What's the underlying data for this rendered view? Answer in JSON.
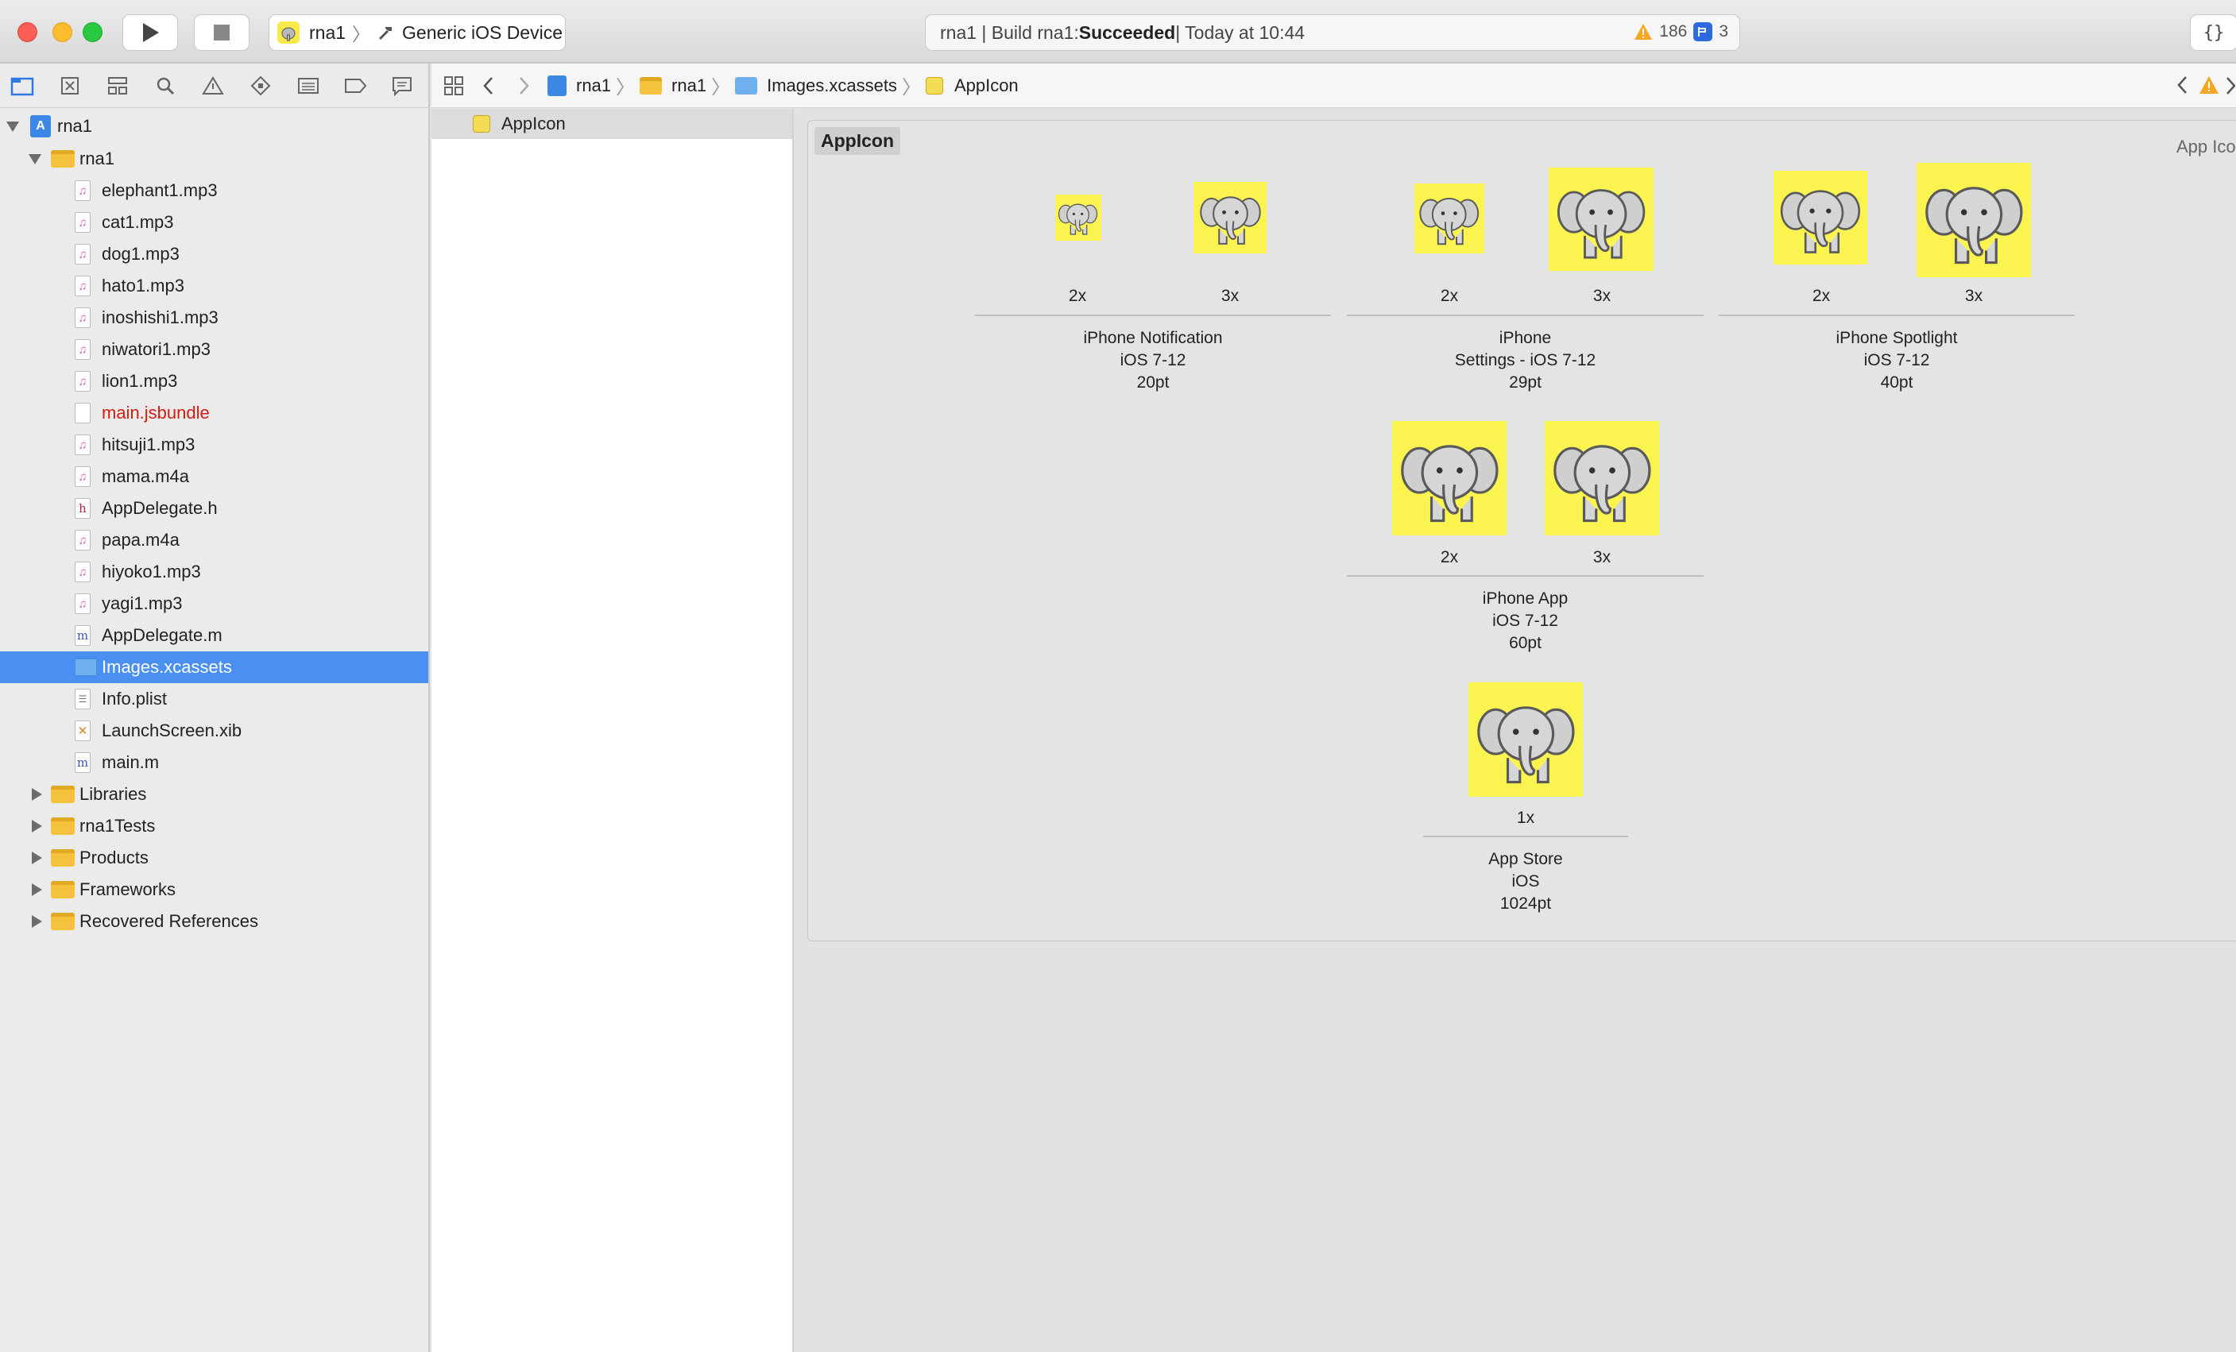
{
  "toolbar": {
    "scheme_name": "rna1",
    "device": "Generic iOS Device",
    "status_prefix": "rna1 | Build rna1: ",
    "status_result": "Succeeded",
    "status_suffix": " | Today at 10:44",
    "warning_count": "186",
    "issue_count": "3",
    "braces": "{}"
  },
  "navigator": {
    "icons": [
      "folder-icon",
      "source-control-icon",
      "hierarchy-icon",
      "find-icon",
      "issue-icon",
      "test-icon",
      "debug-icon",
      "breakpoint-icon",
      "report-icon"
    ],
    "project": "rna1",
    "group": "rna1",
    "files": [
      {
        "name": "elephant1.mp3"
      },
      {
        "name": "cat1.mp3"
      },
      {
        "name": "dog1.mp3"
      },
      {
        "name": "hato1.mp3"
      },
      {
        "name": "inoshishi1.mp3"
      },
      {
        "name": "niwatori1.mp3"
      },
      {
        "name": "lion1.mp3"
      },
      {
        "name": "main.jsbundle"
      },
      {
        "name": "hitsuji1.mp3"
      },
      {
        "name": "mama.m4a"
      },
      {
        "name": "AppDelegate.h"
      },
      {
        "name": "papa.m4a"
      },
      {
        "name": "hiyoko1.mp3"
      },
      {
        "name": "yagi1.mp3"
      },
      {
        "name": "AppDelegate.m"
      },
      {
        "name": "Images.xcassets"
      },
      {
        "name": "Info.plist"
      },
      {
        "name": "LaunchScreen.xib"
      },
      {
        "name": "main.m"
      }
    ],
    "groups": [
      "Libraries",
      "rna1Tests",
      "Products",
      "Frameworks",
      "Recovered References"
    ],
    "file_type_letters": {
      "h": "h",
      "m": "m"
    }
  },
  "jumpbar": {
    "crumbs": [
      "rna1",
      "rna1",
      "Images.xcassets",
      "AppIcon"
    ]
  },
  "asset_list": {
    "items": [
      "AppIcon"
    ]
  },
  "asset_panel": {
    "title": "AppIcon",
    "type_label": "App Icon",
    "groups": [
      {
        "scales": [
          "2x",
          "3x"
        ],
        "caption": [
          "iPhone Notification",
          "iOS 7-12",
          "20pt"
        ]
      },
      {
        "scales": [
          "2x",
          "3x"
        ],
        "caption": [
          "iPhone",
          "Settings - iOS 7-12",
          "29pt"
        ]
      },
      {
        "scales": [
          "2x",
          "3x"
        ],
        "caption": [
          "iPhone Spotlight",
          "iOS 7-12",
          "40pt"
        ]
      },
      {
        "scales": [
          "2x",
          "3x"
        ],
        "caption": [
          "iPhone App",
          "iOS 7-12",
          "60pt"
        ]
      },
      {
        "scales": [
          "1x"
        ],
        "caption": [
          "App Store",
          "iOS",
          "1024pt"
        ]
      }
    ],
    "icon_background": "#fbf450"
  }
}
